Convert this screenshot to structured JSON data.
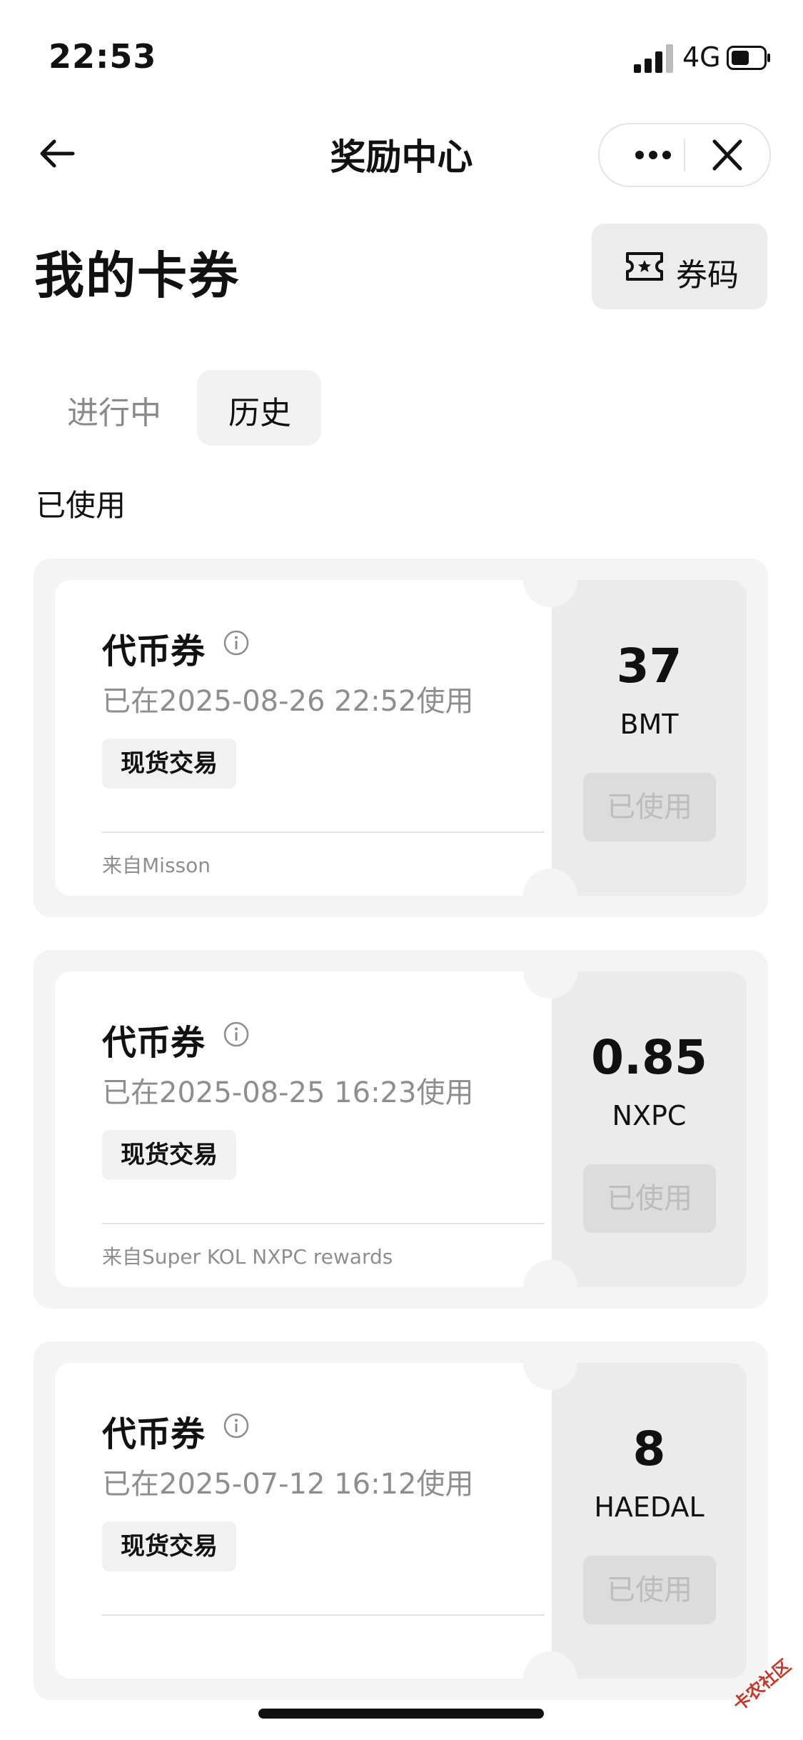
{
  "status_bar": {
    "time": "22:53",
    "network": "4G"
  },
  "nav": {
    "title": "奖励中心"
  },
  "header": {
    "title": "我的卡券",
    "code_button": "券码"
  },
  "tabs": [
    {
      "label": "进行中"
    },
    {
      "label": "历史"
    }
  ],
  "section_label": "已使用",
  "coupons": [
    {
      "type": "代币券",
      "date": "已在2025-08-26 22:52使用",
      "tag": "现货交易",
      "source": "来自Misson",
      "amount": "37",
      "symbol": "BMT",
      "status": "已使用"
    },
    {
      "type": "代币券",
      "date": "已在2025-08-25 16:23使用",
      "tag": "现货交易",
      "source": "来自Super KOL NXPC rewards",
      "amount": "0.85",
      "symbol": "NXPC",
      "status": "已使用"
    },
    {
      "type": "代币券",
      "date": "已在2025-07-12 16:12使用",
      "tag": "现货交易",
      "source": "",
      "amount": "8",
      "symbol": "HAEDAL",
      "status": "已使用"
    }
  ],
  "watermark": "卡农社区"
}
